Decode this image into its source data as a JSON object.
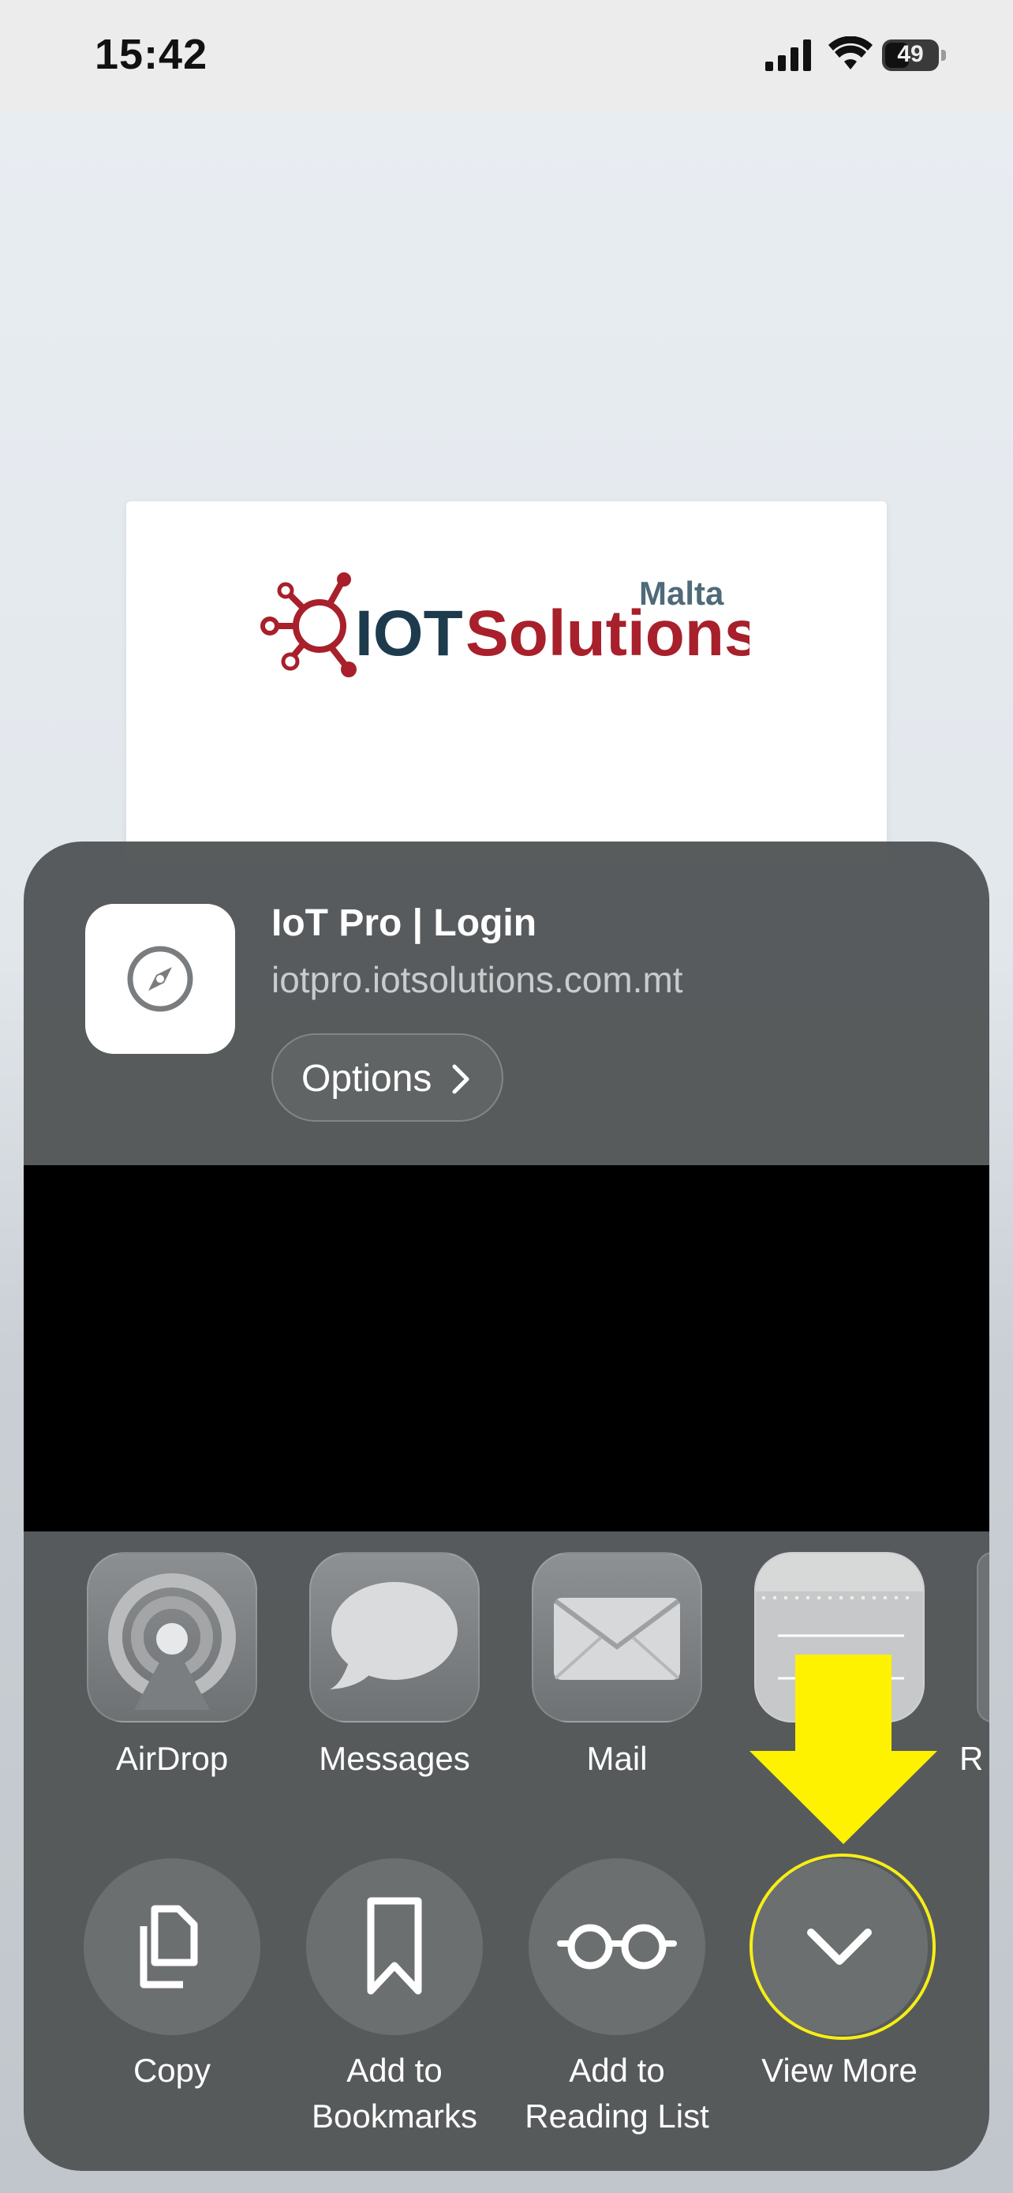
{
  "status_bar": {
    "time": "15:42",
    "battery_percent": "49"
  },
  "background_page": {
    "logo_text_main": "IOT Solutions",
    "logo_text_sub": "Malta"
  },
  "share_sheet": {
    "page_title": "IoT Pro | Login",
    "page_url": "iotpro.iotsolutions.com.mt",
    "options_label": "Options",
    "app_icon": "safari-compass-icon",
    "apps": [
      {
        "label": "AirDrop",
        "icon": "airdrop-icon"
      },
      {
        "label": "Messages",
        "icon": "messages-icon"
      },
      {
        "label": "Mail",
        "icon": "mail-icon"
      },
      {
        "label": "",
        "icon": "notes-icon"
      },
      {
        "label": "R",
        "icon": "partial-app-icon"
      }
    ],
    "actions": [
      {
        "label": "Copy",
        "icon": "copy-icon"
      },
      {
        "label": "Add to Bookmarks",
        "line1": "Add to",
        "line2": "Bookmarks",
        "icon": "bookmark-icon"
      },
      {
        "label": "Add to Reading List",
        "line1": "Add to",
        "line2": "Reading List",
        "icon": "glasses-icon"
      },
      {
        "label": "View More",
        "icon": "chevron-down-icon"
      }
    ]
  },
  "annotation": {
    "highlight_color": "#f6ee16",
    "arrow_icon": "yellow-arrow-down-icon"
  }
}
